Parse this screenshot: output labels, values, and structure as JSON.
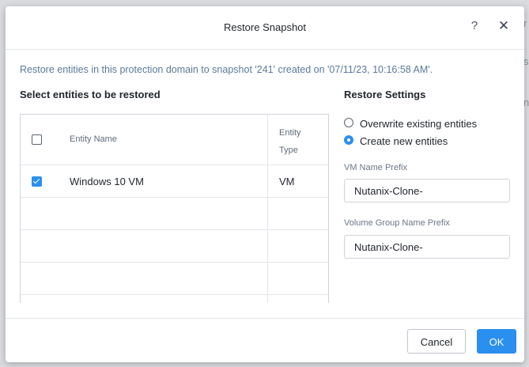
{
  "dialog": {
    "title": "Restore Snapshot",
    "help_icon": "?",
    "close_icon": "✕",
    "description": "Restore entities in this protection domain to snapshot '241' created on '07/11/23, 10:16:58 AM'."
  },
  "entities": {
    "section_title": "Select entities to be restored",
    "columns": {
      "name": "Entity Name",
      "type_line1": "Entity",
      "type_line2": "Type"
    },
    "select_all_checked": false,
    "rows": [
      {
        "name": "Windows 10 VM",
        "type": "VM",
        "checked": true
      }
    ]
  },
  "settings": {
    "section_title": "Restore Settings",
    "options": [
      {
        "label": "Overwrite existing entities",
        "selected": false
      },
      {
        "label": "Create new entities",
        "selected": true
      }
    ],
    "vm_prefix_label": "VM Name Prefix",
    "vm_prefix_value": "Nutanix-Clone-",
    "vg_prefix_label": "Volume Group Name Prefix",
    "vg_prefix_value": "Nutanix-Clone-"
  },
  "footer": {
    "cancel_label": "Cancel",
    "ok_label": "OK"
  },
  "colors": {
    "accent": "#2b8ff0",
    "description_text": "#5a7a9a"
  }
}
